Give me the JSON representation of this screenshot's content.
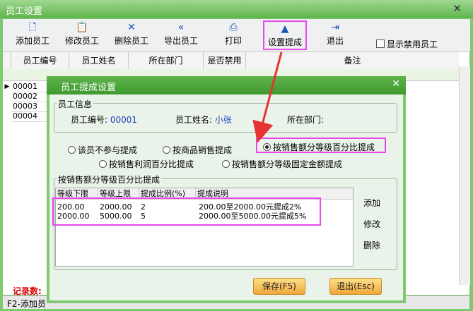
{
  "main": {
    "title": "员工设置",
    "close": "✕",
    "toolbar": {
      "add": "添加员工",
      "edit": "修改员工",
      "delete": "删除员工",
      "export": "导出员工",
      "print": "打印",
      "commission": "设置提成",
      "exit": "退出"
    },
    "show_disabled": "显示禁用员工",
    "columns": [
      "员工编号",
      "员工姓名",
      "所在部门",
      "是否禁用",
      "备注"
    ],
    "rows": [
      "00001",
      "00002",
      "00003",
      "00004"
    ],
    "records_label": "记录数:",
    "status_hint": "F2-添加员"
  },
  "dialog": {
    "title": "员工提成设置",
    "close": "✕",
    "info_group": "员工信息",
    "emp_no_label": "员工编号:",
    "emp_no": "00001",
    "emp_name_label": "员工姓名:",
    "emp_name": "小张",
    "dept_label": "所在部门:",
    "dept": "",
    "options": {
      "none": "该员不参与提成",
      "goods": "按商品销售提成",
      "sales_pct": "按销售额分等级百分比提成",
      "profit_pct": "按销售利润百分比提成",
      "sales_fixed": "按销售额分等级固定金额提成"
    },
    "selected_option": "sales_pct",
    "table_group": "按销售额分等级百分比提成",
    "table": {
      "headers": [
        "等级下限",
        "等级上限",
        "提成比例(%)",
        "提成说明"
      ],
      "rows": [
        [
          "200.00",
          "2000.00",
          "2",
          "200.00至2000.00元提成2%"
        ],
        [
          "2000.00",
          "5000.00",
          "5",
          "2000.00至5000.00元提成5%"
        ]
      ]
    },
    "side": {
      "add": "添加",
      "edit": "修改",
      "delete": "删除"
    },
    "save": "保存(F5)",
    "exit": "退出(Esc)"
  }
}
